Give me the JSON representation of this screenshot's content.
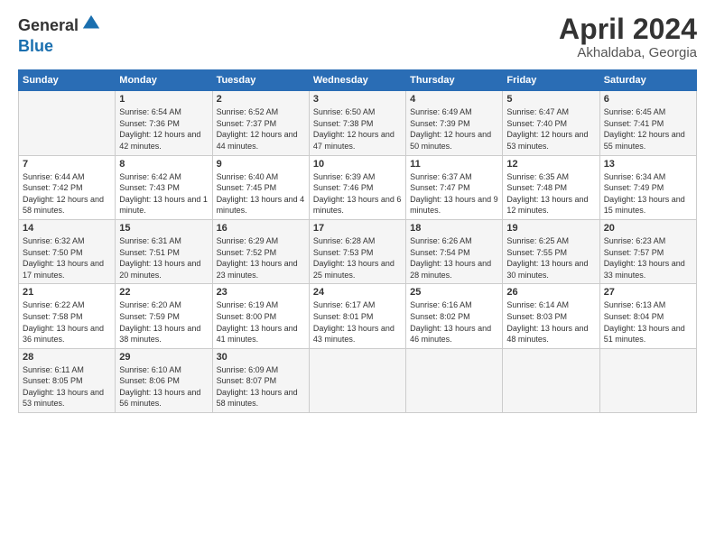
{
  "header": {
    "logo_general": "General",
    "logo_blue": "Blue",
    "title": "April 2024",
    "location": "Akhaldaba, Georgia"
  },
  "weekdays": [
    "Sunday",
    "Monday",
    "Tuesday",
    "Wednesday",
    "Thursday",
    "Friday",
    "Saturday"
  ],
  "weeks": [
    [
      {
        "day": "",
        "sunrise": "",
        "sunset": "",
        "daylight": ""
      },
      {
        "day": "1",
        "sunrise": "Sunrise: 6:54 AM",
        "sunset": "Sunset: 7:36 PM",
        "daylight": "Daylight: 12 hours and 42 minutes."
      },
      {
        "day": "2",
        "sunrise": "Sunrise: 6:52 AM",
        "sunset": "Sunset: 7:37 PM",
        "daylight": "Daylight: 12 hours and 44 minutes."
      },
      {
        "day": "3",
        "sunrise": "Sunrise: 6:50 AM",
        "sunset": "Sunset: 7:38 PM",
        "daylight": "Daylight: 12 hours and 47 minutes."
      },
      {
        "day": "4",
        "sunrise": "Sunrise: 6:49 AM",
        "sunset": "Sunset: 7:39 PM",
        "daylight": "Daylight: 12 hours and 50 minutes."
      },
      {
        "day": "5",
        "sunrise": "Sunrise: 6:47 AM",
        "sunset": "Sunset: 7:40 PM",
        "daylight": "Daylight: 12 hours and 53 minutes."
      },
      {
        "day": "6",
        "sunrise": "Sunrise: 6:45 AM",
        "sunset": "Sunset: 7:41 PM",
        "daylight": "Daylight: 12 hours and 55 minutes."
      }
    ],
    [
      {
        "day": "7",
        "sunrise": "Sunrise: 6:44 AM",
        "sunset": "Sunset: 7:42 PM",
        "daylight": "Daylight: 12 hours and 58 minutes."
      },
      {
        "day": "8",
        "sunrise": "Sunrise: 6:42 AM",
        "sunset": "Sunset: 7:43 PM",
        "daylight": "Daylight: 13 hours and 1 minute."
      },
      {
        "day": "9",
        "sunrise": "Sunrise: 6:40 AM",
        "sunset": "Sunset: 7:45 PM",
        "daylight": "Daylight: 13 hours and 4 minutes."
      },
      {
        "day": "10",
        "sunrise": "Sunrise: 6:39 AM",
        "sunset": "Sunset: 7:46 PM",
        "daylight": "Daylight: 13 hours and 6 minutes."
      },
      {
        "day": "11",
        "sunrise": "Sunrise: 6:37 AM",
        "sunset": "Sunset: 7:47 PM",
        "daylight": "Daylight: 13 hours and 9 minutes."
      },
      {
        "day": "12",
        "sunrise": "Sunrise: 6:35 AM",
        "sunset": "Sunset: 7:48 PM",
        "daylight": "Daylight: 13 hours and 12 minutes."
      },
      {
        "day": "13",
        "sunrise": "Sunrise: 6:34 AM",
        "sunset": "Sunset: 7:49 PM",
        "daylight": "Daylight: 13 hours and 15 minutes."
      }
    ],
    [
      {
        "day": "14",
        "sunrise": "Sunrise: 6:32 AM",
        "sunset": "Sunset: 7:50 PM",
        "daylight": "Daylight: 13 hours and 17 minutes."
      },
      {
        "day": "15",
        "sunrise": "Sunrise: 6:31 AM",
        "sunset": "Sunset: 7:51 PM",
        "daylight": "Daylight: 13 hours and 20 minutes."
      },
      {
        "day": "16",
        "sunrise": "Sunrise: 6:29 AM",
        "sunset": "Sunset: 7:52 PM",
        "daylight": "Daylight: 13 hours and 23 minutes."
      },
      {
        "day": "17",
        "sunrise": "Sunrise: 6:28 AM",
        "sunset": "Sunset: 7:53 PM",
        "daylight": "Daylight: 13 hours and 25 minutes."
      },
      {
        "day": "18",
        "sunrise": "Sunrise: 6:26 AM",
        "sunset": "Sunset: 7:54 PM",
        "daylight": "Daylight: 13 hours and 28 minutes."
      },
      {
        "day": "19",
        "sunrise": "Sunrise: 6:25 AM",
        "sunset": "Sunset: 7:55 PM",
        "daylight": "Daylight: 13 hours and 30 minutes."
      },
      {
        "day": "20",
        "sunrise": "Sunrise: 6:23 AM",
        "sunset": "Sunset: 7:57 PM",
        "daylight": "Daylight: 13 hours and 33 minutes."
      }
    ],
    [
      {
        "day": "21",
        "sunrise": "Sunrise: 6:22 AM",
        "sunset": "Sunset: 7:58 PM",
        "daylight": "Daylight: 13 hours and 36 minutes."
      },
      {
        "day": "22",
        "sunrise": "Sunrise: 6:20 AM",
        "sunset": "Sunset: 7:59 PM",
        "daylight": "Daylight: 13 hours and 38 minutes."
      },
      {
        "day": "23",
        "sunrise": "Sunrise: 6:19 AM",
        "sunset": "Sunset: 8:00 PM",
        "daylight": "Daylight: 13 hours and 41 minutes."
      },
      {
        "day": "24",
        "sunrise": "Sunrise: 6:17 AM",
        "sunset": "Sunset: 8:01 PM",
        "daylight": "Daylight: 13 hours and 43 minutes."
      },
      {
        "day": "25",
        "sunrise": "Sunrise: 6:16 AM",
        "sunset": "Sunset: 8:02 PM",
        "daylight": "Daylight: 13 hours and 46 minutes."
      },
      {
        "day": "26",
        "sunrise": "Sunrise: 6:14 AM",
        "sunset": "Sunset: 8:03 PM",
        "daylight": "Daylight: 13 hours and 48 minutes."
      },
      {
        "day": "27",
        "sunrise": "Sunrise: 6:13 AM",
        "sunset": "Sunset: 8:04 PM",
        "daylight": "Daylight: 13 hours and 51 minutes."
      }
    ],
    [
      {
        "day": "28",
        "sunrise": "Sunrise: 6:11 AM",
        "sunset": "Sunset: 8:05 PM",
        "daylight": "Daylight: 13 hours and 53 minutes."
      },
      {
        "day": "29",
        "sunrise": "Sunrise: 6:10 AM",
        "sunset": "Sunset: 8:06 PM",
        "daylight": "Daylight: 13 hours and 56 minutes."
      },
      {
        "day": "30",
        "sunrise": "Sunrise: 6:09 AM",
        "sunset": "Sunset: 8:07 PM",
        "daylight": "Daylight: 13 hours and 58 minutes."
      },
      {
        "day": "",
        "sunrise": "",
        "sunset": "",
        "daylight": ""
      },
      {
        "day": "",
        "sunrise": "",
        "sunset": "",
        "daylight": ""
      },
      {
        "day": "",
        "sunrise": "",
        "sunset": "",
        "daylight": ""
      },
      {
        "day": "",
        "sunrise": "",
        "sunset": "",
        "daylight": ""
      }
    ]
  ]
}
